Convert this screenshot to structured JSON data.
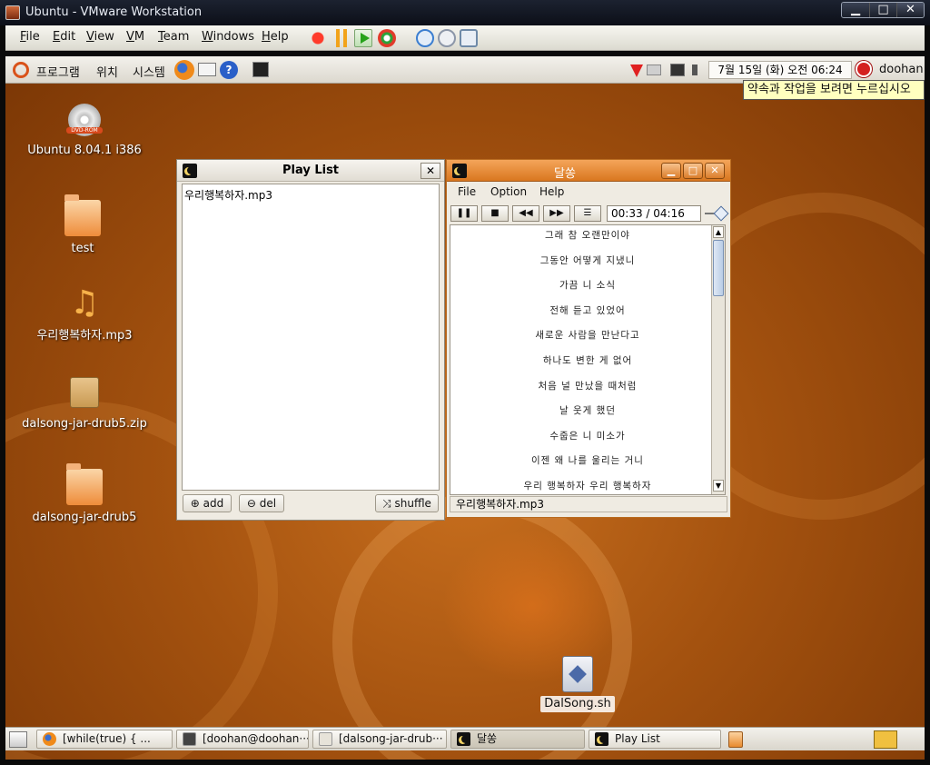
{
  "vm": {
    "title": "Ubuntu - VMware Workstation",
    "controls": [
      "▁",
      "□",
      "✕"
    ],
    "menu": [
      {
        "key": "F",
        "rest": "ile"
      },
      {
        "key": "E",
        "rest": "dit"
      },
      {
        "key": "V",
        "rest": "iew"
      },
      {
        "key": "V",
        "rest": "M"
      },
      {
        "key": "T",
        "rest": "eam"
      },
      {
        "key": "W",
        "rest": "indows"
      },
      {
        "key": "H",
        "rest": "elp"
      }
    ],
    "toolbar_icons": [
      "power-off-icon",
      "suspend-icon",
      "power-on-icon",
      "reset-icon",
      "snapshot-icon",
      "revert-snapshot-icon",
      "snapshot-manager-icon"
    ]
  },
  "guest": {
    "top_panel": {
      "menus": [
        "프로그램",
        "위치",
        "시스템"
      ],
      "clock": "7월 15일 (화) 오전 06:24",
      "user": "doohan",
      "tooltip": "약속과 작업을 보려면 누르십시오"
    },
    "desktop_icons": [
      {
        "label": "Ubuntu 8.04.1 i386",
        "badge": "DVD-ROM",
        "icon": "dvd-rom-icon"
      },
      {
        "label": "test",
        "icon": "folder-icon"
      },
      {
        "label": "우리행복하자.mp3",
        "icon": "music-note-icon"
      },
      {
        "label": "dalsong-jar-drub5.zip",
        "icon": "archive-icon"
      },
      {
        "label": "dalsong-jar-drub5",
        "icon": "folder-icon"
      }
    ],
    "dalsong_sh": {
      "label": "DalSong.sh"
    },
    "playlist": {
      "title": "Play List",
      "items": [
        "우리행복하자.mp3"
      ],
      "buttons": {
        "add": "add",
        "del": "del",
        "shuffle": "shuffle"
      }
    },
    "player": {
      "title": "달쏭",
      "menu": [
        "File",
        "Option",
        "Help"
      ],
      "time": "00:33 / 04:16",
      "lyrics": [
        "그래 참 오랜만이야",
        "그동안 어떻게 지냈니",
        "가끔 니 소식",
        "전해 듣고 있었어",
        "새로운 사람을 만난다고",
        "하나도 변한 게 없어",
        "처음 널 만났을 때처럼",
        "날 웃게 했던",
        "수줍은 니 미소가",
        "이젠 왜 나를 울리는 거니",
        "우리 행복하자 우리 행복하자"
      ],
      "status": "우리행복하자.mp3"
    },
    "taskbar": [
      {
        "label": "[while(true) { ...",
        "icon": "firefox-icon"
      },
      {
        "label": "[doohan@doohan···",
        "icon": "terminal-icon"
      },
      {
        "label": "[dalsong-jar-drub···",
        "icon": "file-manager-icon"
      },
      {
        "label": "달쏭",
        "icon": "dalsong-icon"
      },
      {
        "label": "Play List",
        "icon": "dalsong-icon"
      }
    ]
  }
}
